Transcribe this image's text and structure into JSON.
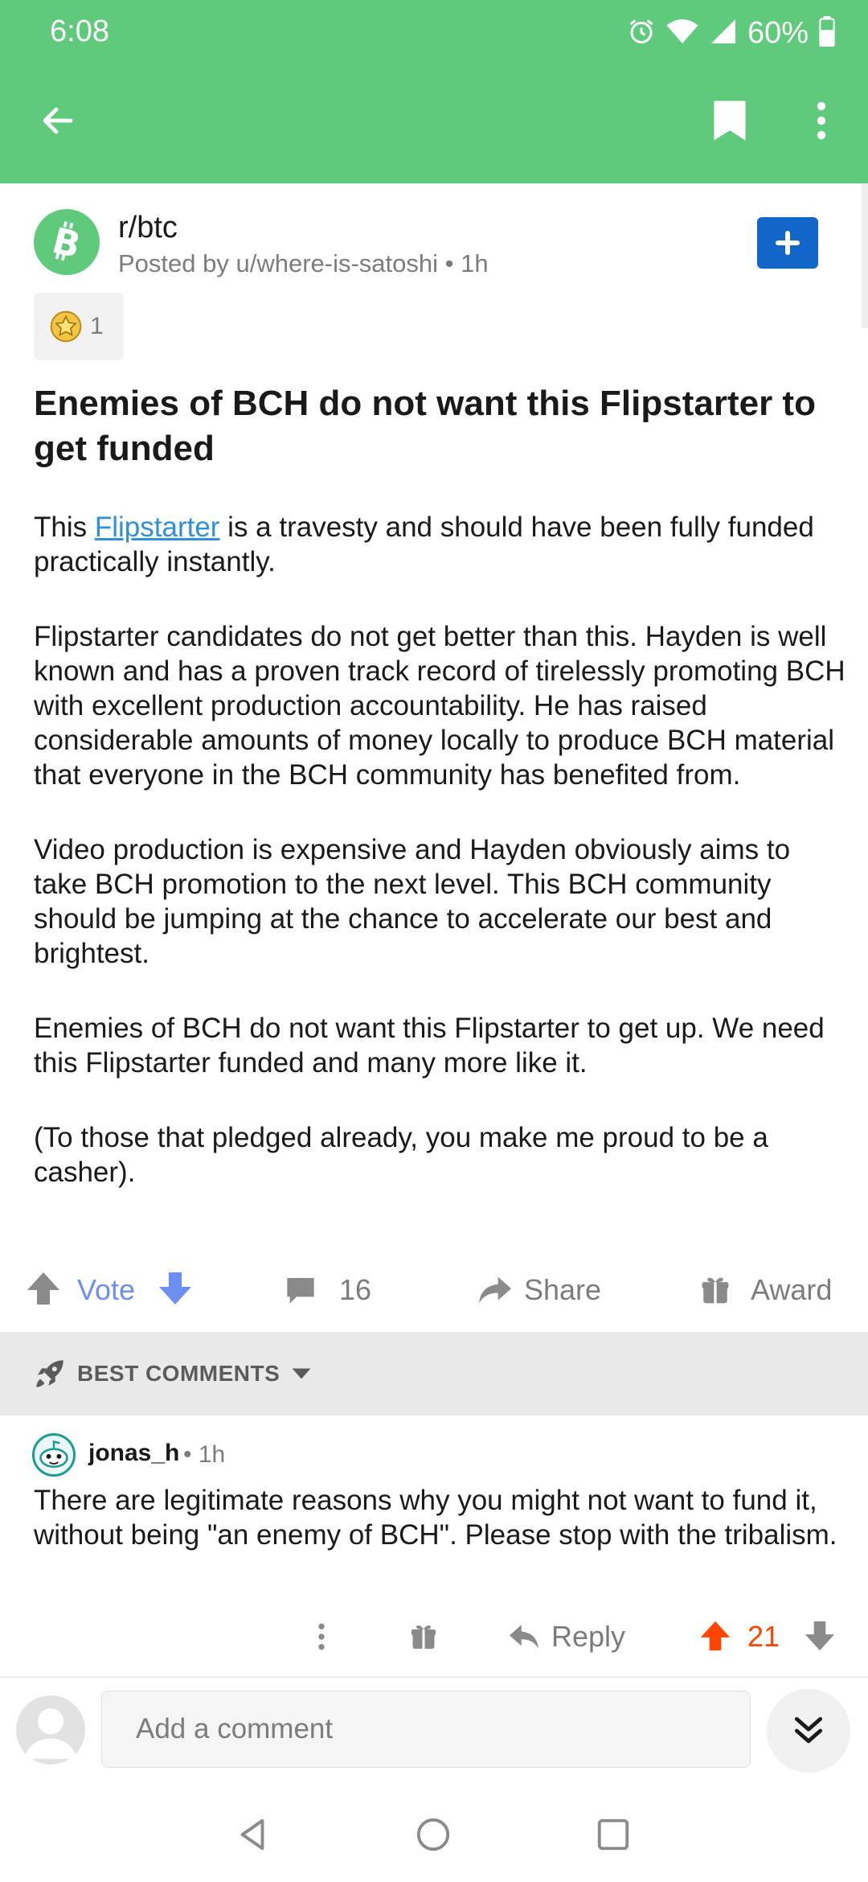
{
  "status_bar": {
    "time": "6:08",
    "battery_percent": "60%",
    "icons": [
      "alarm-icon",
      "wifi-icon",
      "signal-icon",
      "battery-icon"
    ]
  },
  "app_bar": {
    "icons": [
      "back-arrow-icon",
      "bookmark-icon",
      "more-vert-icon"
    ],
    "color": "#5fca7b"
  },
  "post": {
    "subreddit": "r/btc",
    "posted_by": "Posted by u/where-is-satoshi",
    "time": "1h",
    "award_count": "1",
    "title": "Enemies of BCH do not want this Flipstarter to get funded",
    "paragraph1_before": "This ",
    "paragraph1_link": "Flipstarter",
    "paragraph1_after": " is a travesty and should have been fully funded practically instantly.",
    "paragraph2": "Flipstarter candidates do not get better than this. Hayden is well known and has a proven track record of tirelessly promoting BCH with excellent production accountability. He has raised considerable amounts of money locally to produce BCH material that everyone in the BCH community has benefited from.",
    "paragraph3": "Video production is expensive and Hayden obviously aims to take BCH promotion to the next level. This BCH community should be jumping at the chance to accelerate our best and brightest.",
    "paragraph4": "Enemies of BCH do not want this Flipstarter to get up. We need this Flipstarter funded and many more like it.",
    "paragraph5": "(To those that pledged already, you make me proud to be a casher)."
  },
  "post_actions": {
    "vote_label": "Vote",
    "comment_count": "16",
    "share_label": "Share",
    "award_label": "Award"
  },
  "sort": {
    "label": "BEST COMMENTS"
  },
  "comment": {
    "username": "jonas_h",
    "time": "• 1h",
    "body": "There are legitimate reasons why you might not want to fund it, without being \"an enemy of BCH\". Please stop with the tribalism.",
    "reply_label": "Reply",
    "score": "21"
  },
  "composer": {
    "placeholder": "Add a comment"
  },
  "colors": {
    "header_green": "#5fca7b",
    "join_blue": "#1265c9",
    "link_blue": "#2f8fd8",
    "vote_blue": "#6c8ff1",
    "upvote_orange": "#ff4500"
  }
}
